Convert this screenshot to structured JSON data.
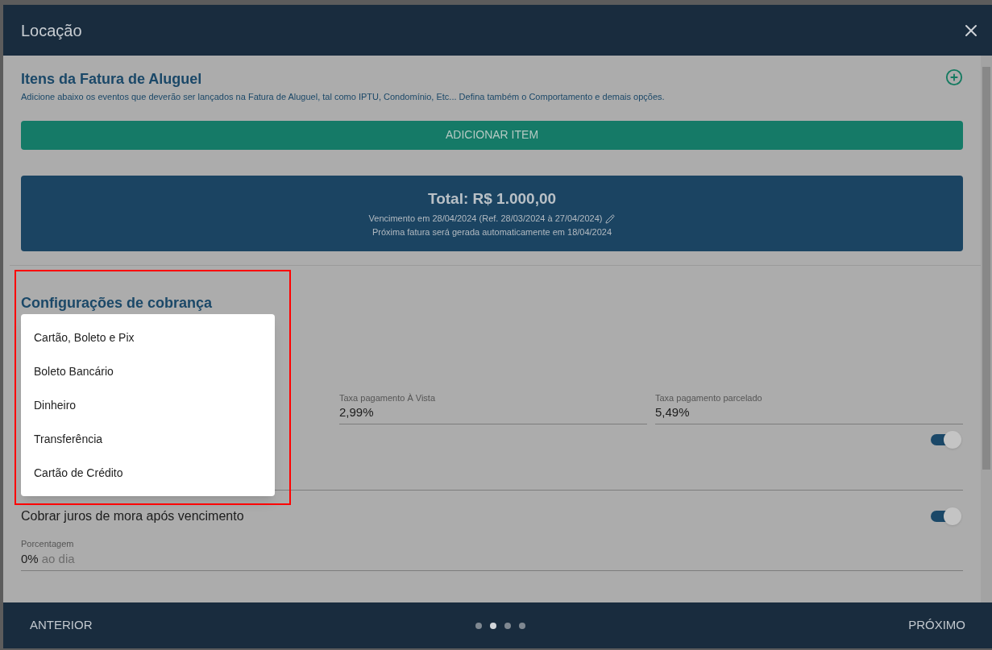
{
  "dialog": {
    "title": "Locação"
  },
  "invoice_items": {
    "title": "Itens da Fatura de Aluguel",
    "description": "Adicione abaixo os eventos que deverão ser lançados na Fatura de Aluguel, tal como IPTU, Condomínio, Etc... Defina também o Comportamento e demais opções.",
    "add_button": "ADICIONAR ITEM"
  },
  "total": {
    "amount": "Total: R$ 1.000,00",
    "due": "Vencimento em 28/04/2024 (Ref. 28/03/2024 à 27/04/2024)",
    "next_invoice": "Próxima fatura será gerada automaticamente em 18/04/2024"
  },
  "billing": {
    "title": "Configurações de cobrança",
    "fee_fields": [
      {
        "label": "Taxa pagamento À Vista",
        "value": "2,99%"
      },
      {
        "label": "Taxa pagamento parcelado",
        "value": "5,49%"
      }
    ],
    "fee_toggle": {
      "on": true
    },
    "late_interest": {
      "label": "Cobrar juros de mora após vencimento",
      "on": true,
      "field_label": "Porcentagem",
      "value": "0%",
      "suffix": "ao dia"
    }
  },
  "payment_menu": {
    "items": [
      {
        "label": "Cartão, Boleto e Pix"
      },
      {
        "label": "Boleto Bancário"
      },
      {
        "label": "Dinheiro"
      },
      {
        "label": "Transferência"
      },
      {
        "label": "Cartão de Crédito"
      }
    ]
  },
  "footer": {
    "previous": "ANTERIOR",
    "next": "PRÓXIMO",
    "pages": [
      {
        "selected": false
      },
      {
        "selected": true
      },
      {
        "selected": false
      },
      {
        "selected": false
      }
    ]
  }
}
